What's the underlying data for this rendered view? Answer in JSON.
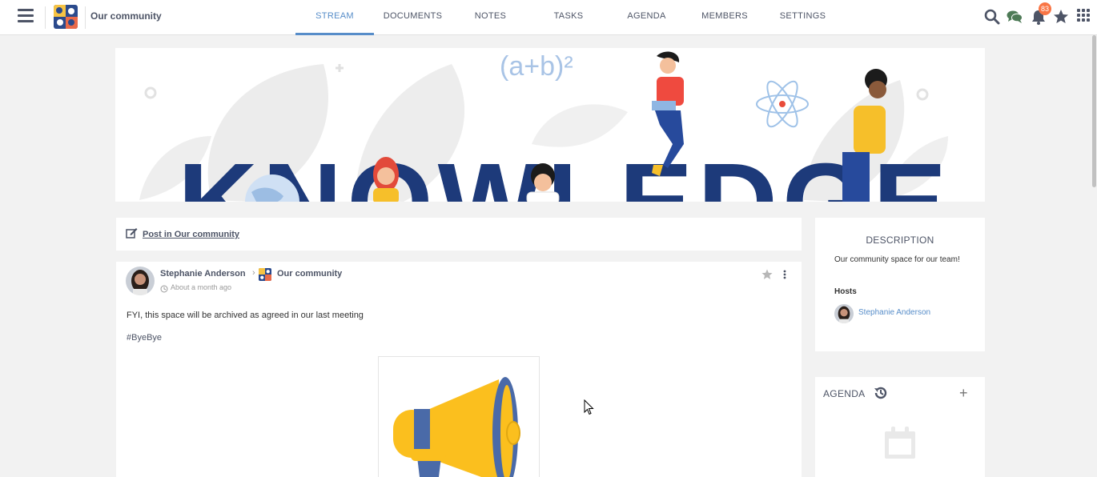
{
  "topbar": {
    "space_name": "Our community",
    "tabs": [
      {
        "label": "STREAM",
        "active": true
      },
      {
        "label": "DOCUMENTS",
        "active": false
      },
      {
        "label": "NOTES",
        "active": false
      },
      {
        "label": "TASKS",
        "active": false
      },
      {
        "label": "AGENDA",
        "active": false
      },
      {
        "label": "MEMBERS",
        "active": false
      },
      {
        "label": "SETTINGS",
        "active": false
      }
    ],
    "notification_count": "83",
    "icons": [
      "menu-icon",
      "search-icon",
      "chat-icon",
      "bell-icon",
      "star-icon",
      "apps-grid-icon"
    ]
  },
  "banner": {
    "formula": "(a+b)²",
    "word": "KNOWLEDGE"
  },
  "composer": {
    "label": "Post in Our community"
  },
  "activity": {
    "author": "Stephanie Anderson",
    "arrow": "›",
    "space": "Our community",
    "time": "About a month ago",
    "text": "FYI, this space will be archived as agreed in our last meeting",
    "hashtag": "#ByeBye"
  },
  "description": {
    "title": "DESCRIPTION",
    "text": "Our community space for our team!",
    "hosts_label": "Hosts",
    "host_name": "Stephanie Anderson"
  },
  "agenda": {
    "title": "AGENDA",
    "add_label": "+"
  },
  "colors": {
    "accent": "#578dc9",
    "text_primary": "#4d5466",
    "badge": "#f97545",
    "banner_navy": "#1d3a7a",
    "megaphone_yellow": "#fbbf1e",
    "megaphone_blue": "#4a6aa8"
  }
}
